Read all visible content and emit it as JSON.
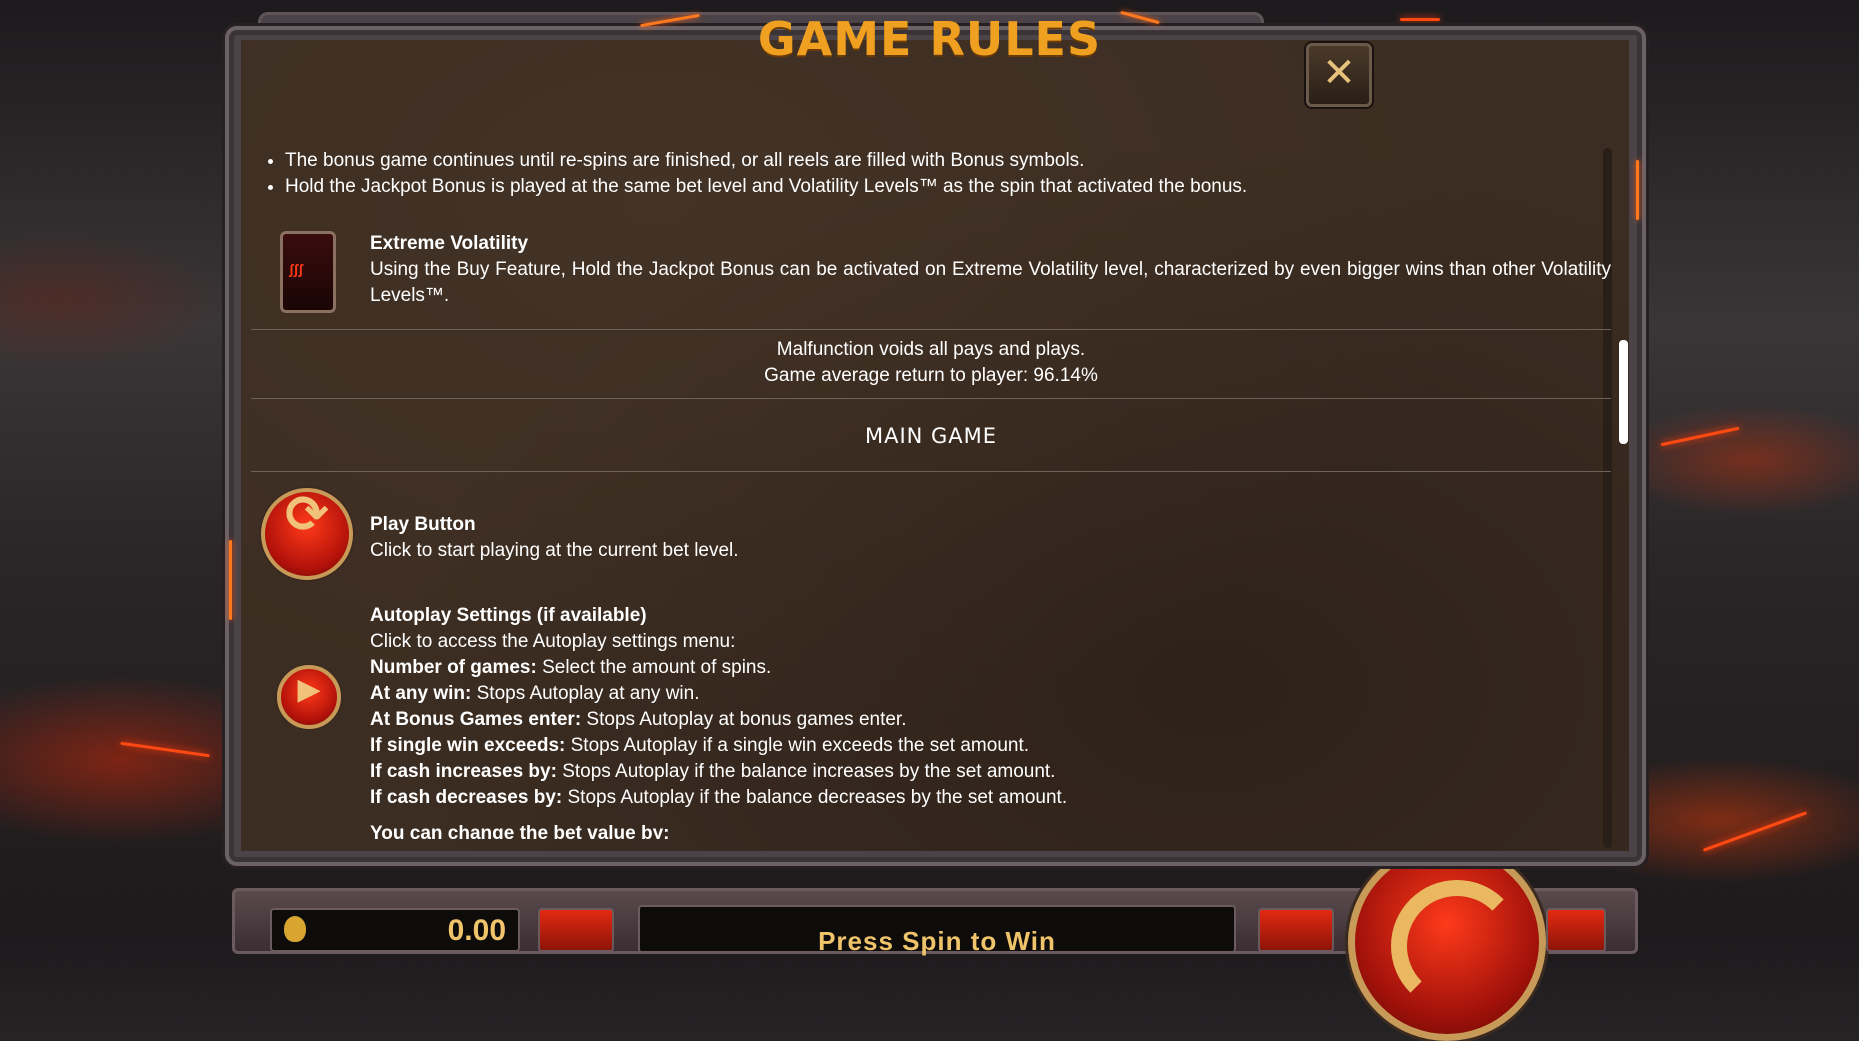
{
  "bottom_bar": {
    "balance": "0.00",
    "message": "Press Spin to Win"
  },
  "modal": {
    "title": "GAME RULES",
    "close_icon": "close-x-icon"
  },
  "rules": {
    "bullets": [
      "The bonus game continues until re-spins are finished, or all reels are filled with Bonus symbols.",
      "Hold the Jackpot Bonus is played at the same bet level and Volatility Levels™ as the spin that activated the bonus."
    ],
    "extreme_volatility": {
      "title": "Extreme Volatility",
      "text": "Using the Buy Feature, Hold the Jackpot Bonus can be activated on Extreme Volatility level, characterized by even bigger wins than other Volatility Levels™.",
      "icon": "extreme-volatility-card-icon"
    },
    "malfunction": "Malfunction voids all pays and plays.",
    "rtp": "Game average return to player: 96.14%",
    "main_game_heading": "MAIN GAME",
    "play_button": {
      "title": "Play Button",
      "text": "Click to start playing at the current bet level.",
      "icon": "spin-arrows-icon"
    },
    "autoplay": {
      "title": "Autoplay Settings (if available)",
      "intro": "Click to access the Autoplay settings menu:",
      "icon": "autoplay-icon",
      "items": [
        {
          "label": "Number of games:",
          "text": " Select the amount of spins."
        },
        {
          "label": "At any win:",
          "text": " Stops Autoplay at any win."
        },
        {
          "label": "At Bonus Games enter:",
          "text": " Stops Autoplay at bonus games enter."
        },
        {
          "label": "If single win exceeds:",
          "text": " Stops Autoplay if a single win exceeds the set amount."
        },
        {
          "label": "If cash increases by:",
          "text": " Stops Autoplay if the balance increases by the set amount."
        },
        {
          "label": "If cash decreases by:",
          "text": " Stops Autoplay if the balance decreases by the set amount."
        }
      ]
    },
    "bet_change": "You can change the bet value by:"
  },
  "colors": {
    "title_gold": "#f0a020",
    "panel_brown": "#3c2d22",
    "frame_stone": "#4b4347",
    "accent_red": "#b3120a"
  }
}
